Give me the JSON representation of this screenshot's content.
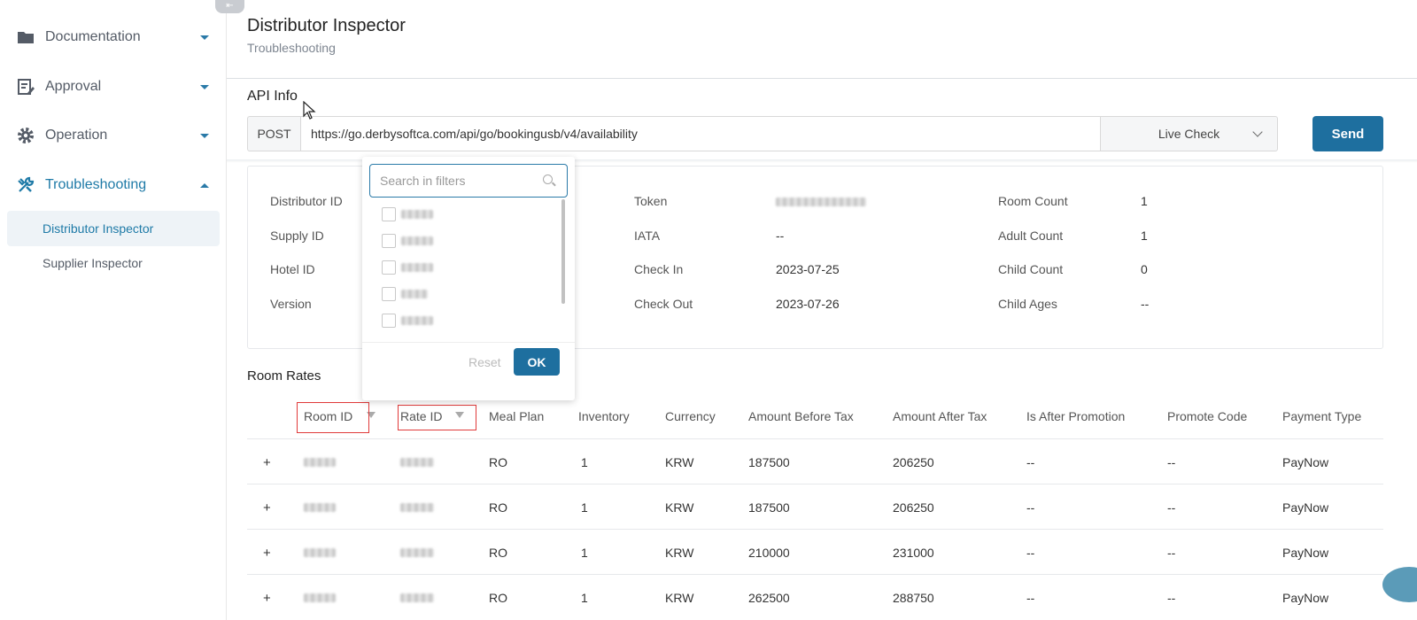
{
  "sidebar": {
    "items": [
      {
        "label": "Documentation",
        "icon": "folder-icon"
      },
      {
        "label": "Approval",
        "icon": "document-edit-icon"
      },
      {
        "label": "Operation",
        "icon": "gear-icon"
      },
      {
        "label": "Troubleshooting",
        "icon": "wrench-icon"
      }
    ],
    "subitems": [
      {
        "label": "Distributor Inspector"
      },
      {
        "label": "Supplier Inspector"
      }
    ]
  },
  "header": {
    "title": "Distributor Inspector",
    "breadcrumb": "Troubleshooting"
  },
  "api_info": {
    "section_label": "API Info",
    "method": "POST",
    "url": "https://go.derbysoftca.com/api/go/bookingusb/v4/availability",
    "mode": "Live Check",
    "send_label": "Send"
  },
  "details": {
    "distributor_id_label": "Distributor ID",
    "supply_id_label": "Supply ID",
    "hotel_id_label": "Hotel ID",
    "version_label": "Version",
    "token_label": "Token",
    "iata_label": "IATA",
    "iata_value": "--",
    "check_in_label": "Check In",
    "check_in_value": "2023-07-25",
    "check_out_label": "Check Out",
    "check_out_value": "2023-07-26",
    "room_count_label": "Room Count",
    "room_count_value": "1",
    "adult_count_label": "Adult Count",
    "adult_count_value": "1",
    "child_count_label": "Child Count",
    "child_count_value": "0",
    "child_ages_label": "Child Ages",
    "child_ages_value": "--"
  },
  "filter_popover": {
    "search_placeholder": "Search in filters",
    "reset_label": "Reset",
    "ok_label": "OK"
  },
  "room_rates": {
    "section_label": "Room Rates",
    "columns": [
      "Room ID",
      "Rate ID",
      "Meal Plan",
      "Inventory",
      "Currency",
      "Amount Before Tax",
      "Amount After Tax",
      "Is After Promotion",
      "Promote Code",
      "Payment Type"
    ],
    "rows": [
      {
        "meal_plan": "RO",
        "inventory": "1",
        "currency": "KRW",
        "before_tax": "187500",
        "after_tax": "206250",
        "after_promotion": "--",
        "promote_code": "--",
        "payment_type": "PayNow"
      },
      {
        "meal_plan": "RO",
        "inventory": "1",
        "currency": "KRW",
        "before_tax": "187500",
        "after_tax": "206250",
        "after_promotion": "--",
        "promote_code": "--",
        "payment_type": "PayNow"
      },
      {
        "meal_plan": "RO",
        "inventory": "1",
        "currency": "KRW",
        "before_tax": "210000",
        "after_tax": "231000",
        "after_promotion": "--",
        "promote_code": "--",
        "payment_type": "PayNow"
      },
      {
        "meal_plan": "RO",
        "inventory": "1",
        "currency": "KRW",
        "before_tax": "262500",
        "after_tax": "288750",
        "after_promotion": "--",
        "promote_code": "--",
        "payment_type": "PayNow"
      }
    ],
    "expand_symbol": "+"
  },
  "colors": {
    "accent": "#1e6f9f",
    "highlight": "#e03a3a"
  }
}
